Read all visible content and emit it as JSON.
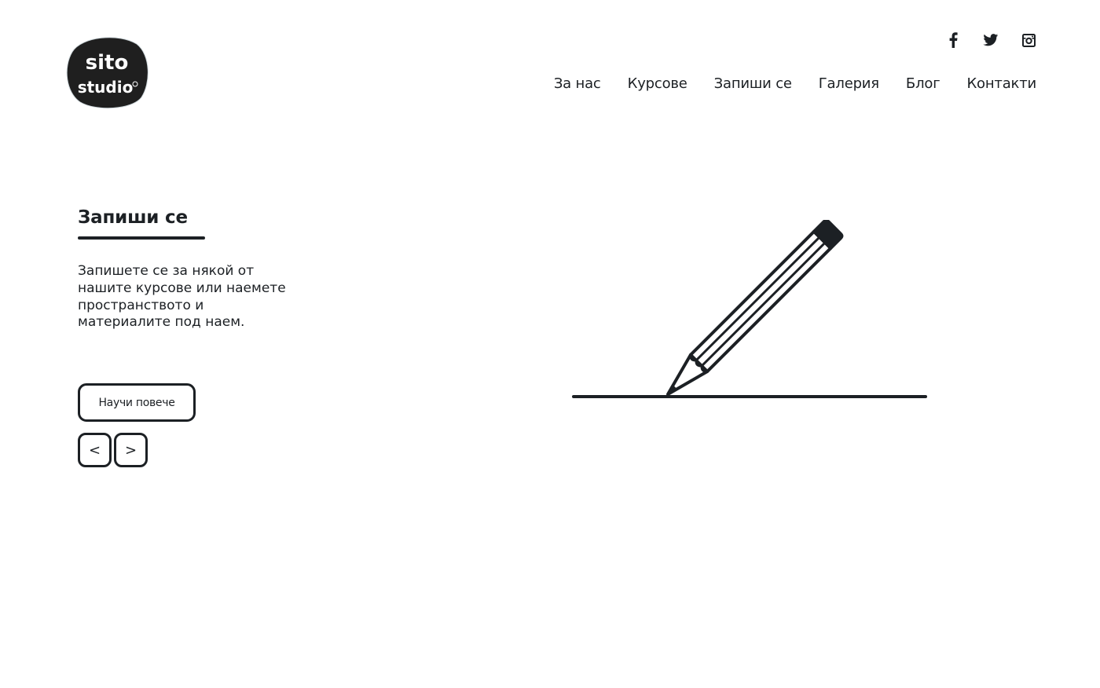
{
  "logo": {
    "line1": "sito",
    "line2": "studio"
  },
  "social": [
    {
      "icon": "facebook-icon",
      "glyph": "f"
    },
    {
      "icon": "twitter-icon",
      "glyph": "bird"
    },
    {
      "icon": "instagram-icon",
      "glyph": "camera"
    }
  ],
  "nav": {
    "items": [
      {
        "label": "За нас"
      },
      {
        "label": "Курсове"
      },
      {
        "label": "Запиши се"
      },
      {
        "label": "Галерия"
      },
      {
        "label": "Блог"
      },
      {
        "label": "Контакти"
      }
    ]
  },
  "hero": {
    "title": "Запиши се",
    "description": "Запишете се за някой от нашите курсове или наемете пространството и материалите под наем.",
    "cta_label": "Научи повече",
    "prev_label": "<",
    "next_label": ">"
  },
  "colors": {
    "text": "#1c2024",
    "background": "#ffffff",
    "logo_bg": "#1f1f1f"
  }
}
